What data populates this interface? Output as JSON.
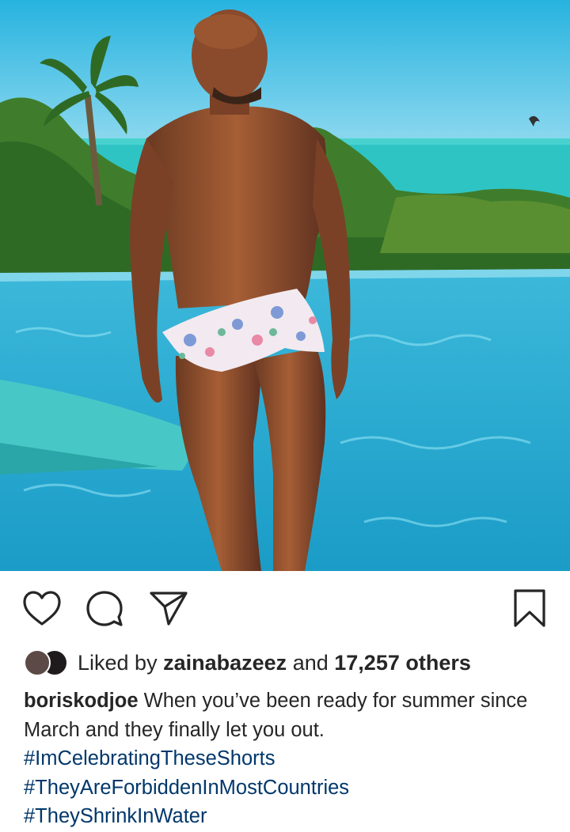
{
  "post": {
    "image_alt": "Man in floral swim shorts standing in an infinity pool with ocean and palm trees behind",
    "liked_by_prefix": "Liked by",
    "liked_by_user": "zainabazeez",
    "liked_by_middle": "and",
    "liked_by_count": "17,257 others",
    "caption_user": "boriskodjoe",
    "caption_text": "When you’ve been ready for summer since March and they finally let you out.",
    "hashtags": [
      "#ImCelebratingTheseShorts",
      "#TheyAreForbiddenInMostCountries",
      "#TheyShrinkInWater"
    ]
  },
  "icons": {
    "like": "heart-icon",
    "comment": "comment-bubble-icon",
    "share": "paper-plane-icon",
    "save": "bookmark-icon"
  },
  "colors": {
    "text": "#262626",
    "hashtag": "#00376b",
    "background": "#ffffff"
  }
}
